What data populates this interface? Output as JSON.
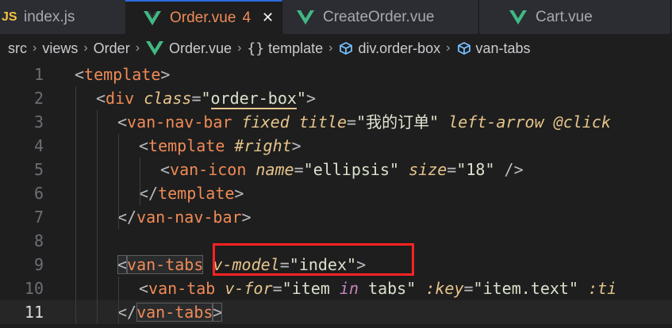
{
  "tabs": [
    {
      "icon": "JS",
      "label": "index.js"
    },
    {
      "label": "Order.vue",
      "problem_count": "4",
      "close": "✕"
    },
    {
      "label": "CreateOrder.vue"
    },
    {
      "label": "Cart.vue"
    }
  ],
  "breadcrumb": {
    "items": [
      "src",
      "views",
      "Order",
      "Order.vue",
      "template",
      "div.order-box",
      "van-tabs"
    ],
    "separator": "›"
  },
  "editor": {
    "active_line": 11,
    "line_numbers": [
      "1",
      "2",
      "3",
      "4",
      "5",
      "6",
      "7",
      "8",
      "9",
      "10",
      "11"
    ],
    "lines": [
      "<template>",
      "<div class=\"order-box\">",
      "<van-nav-bar fixed title=\"我的订单\" left-arrow @click",
      "<template #right>",
      "<van-icon name=\"ellipsis\" size=\"18\" />",
      "</template>",
      "</van-nav-bar>",
      "",
      "<van-tabs v-model=\"index\">",
      "<van-tab v-for=\"item in tabs\" :key=\"item.text\" :ti",
      "</van-tabs>"
    ],
    "tokens": {
      "lt": "<",
      "gt": ">",
      "lt_slash": "</",
      "self_close": " />",
      "eq": "=",
      "quote": "\"",
      "template": "template",
      "div": "div",
      "class": "class",
      "order_box": "order-box",
      "van_nav_bar": "van-nav-bar",
      "fixed": "fixed",
      "title": "title",
      "title_value": "我的订单",
      "left_arrow": "left-arrow",
      "click": "@click",
      "right": "#right",
      "van_icon": "van-icon",
      "name": "name",
      "name_value": "ellipsis",
      "size": "size",
      "size_value": "18",
      "van_tabs": "van-tabs",
      "v_model": "v-model",
      "index": "index",
      "van_tab": "van-tab",
      "v_for": "v-for",
      "item": "item",
      "in": "in",
      "tabs": "tabs",
      "key": ":key",
      "item_text": "item.text",
      "ti": ":ti"
    }
  },
  "colors": {
    "accent": "#ef8b57",
    "highlight": "#ff2222",
    "background": "#1e1e1e"
  }
}
